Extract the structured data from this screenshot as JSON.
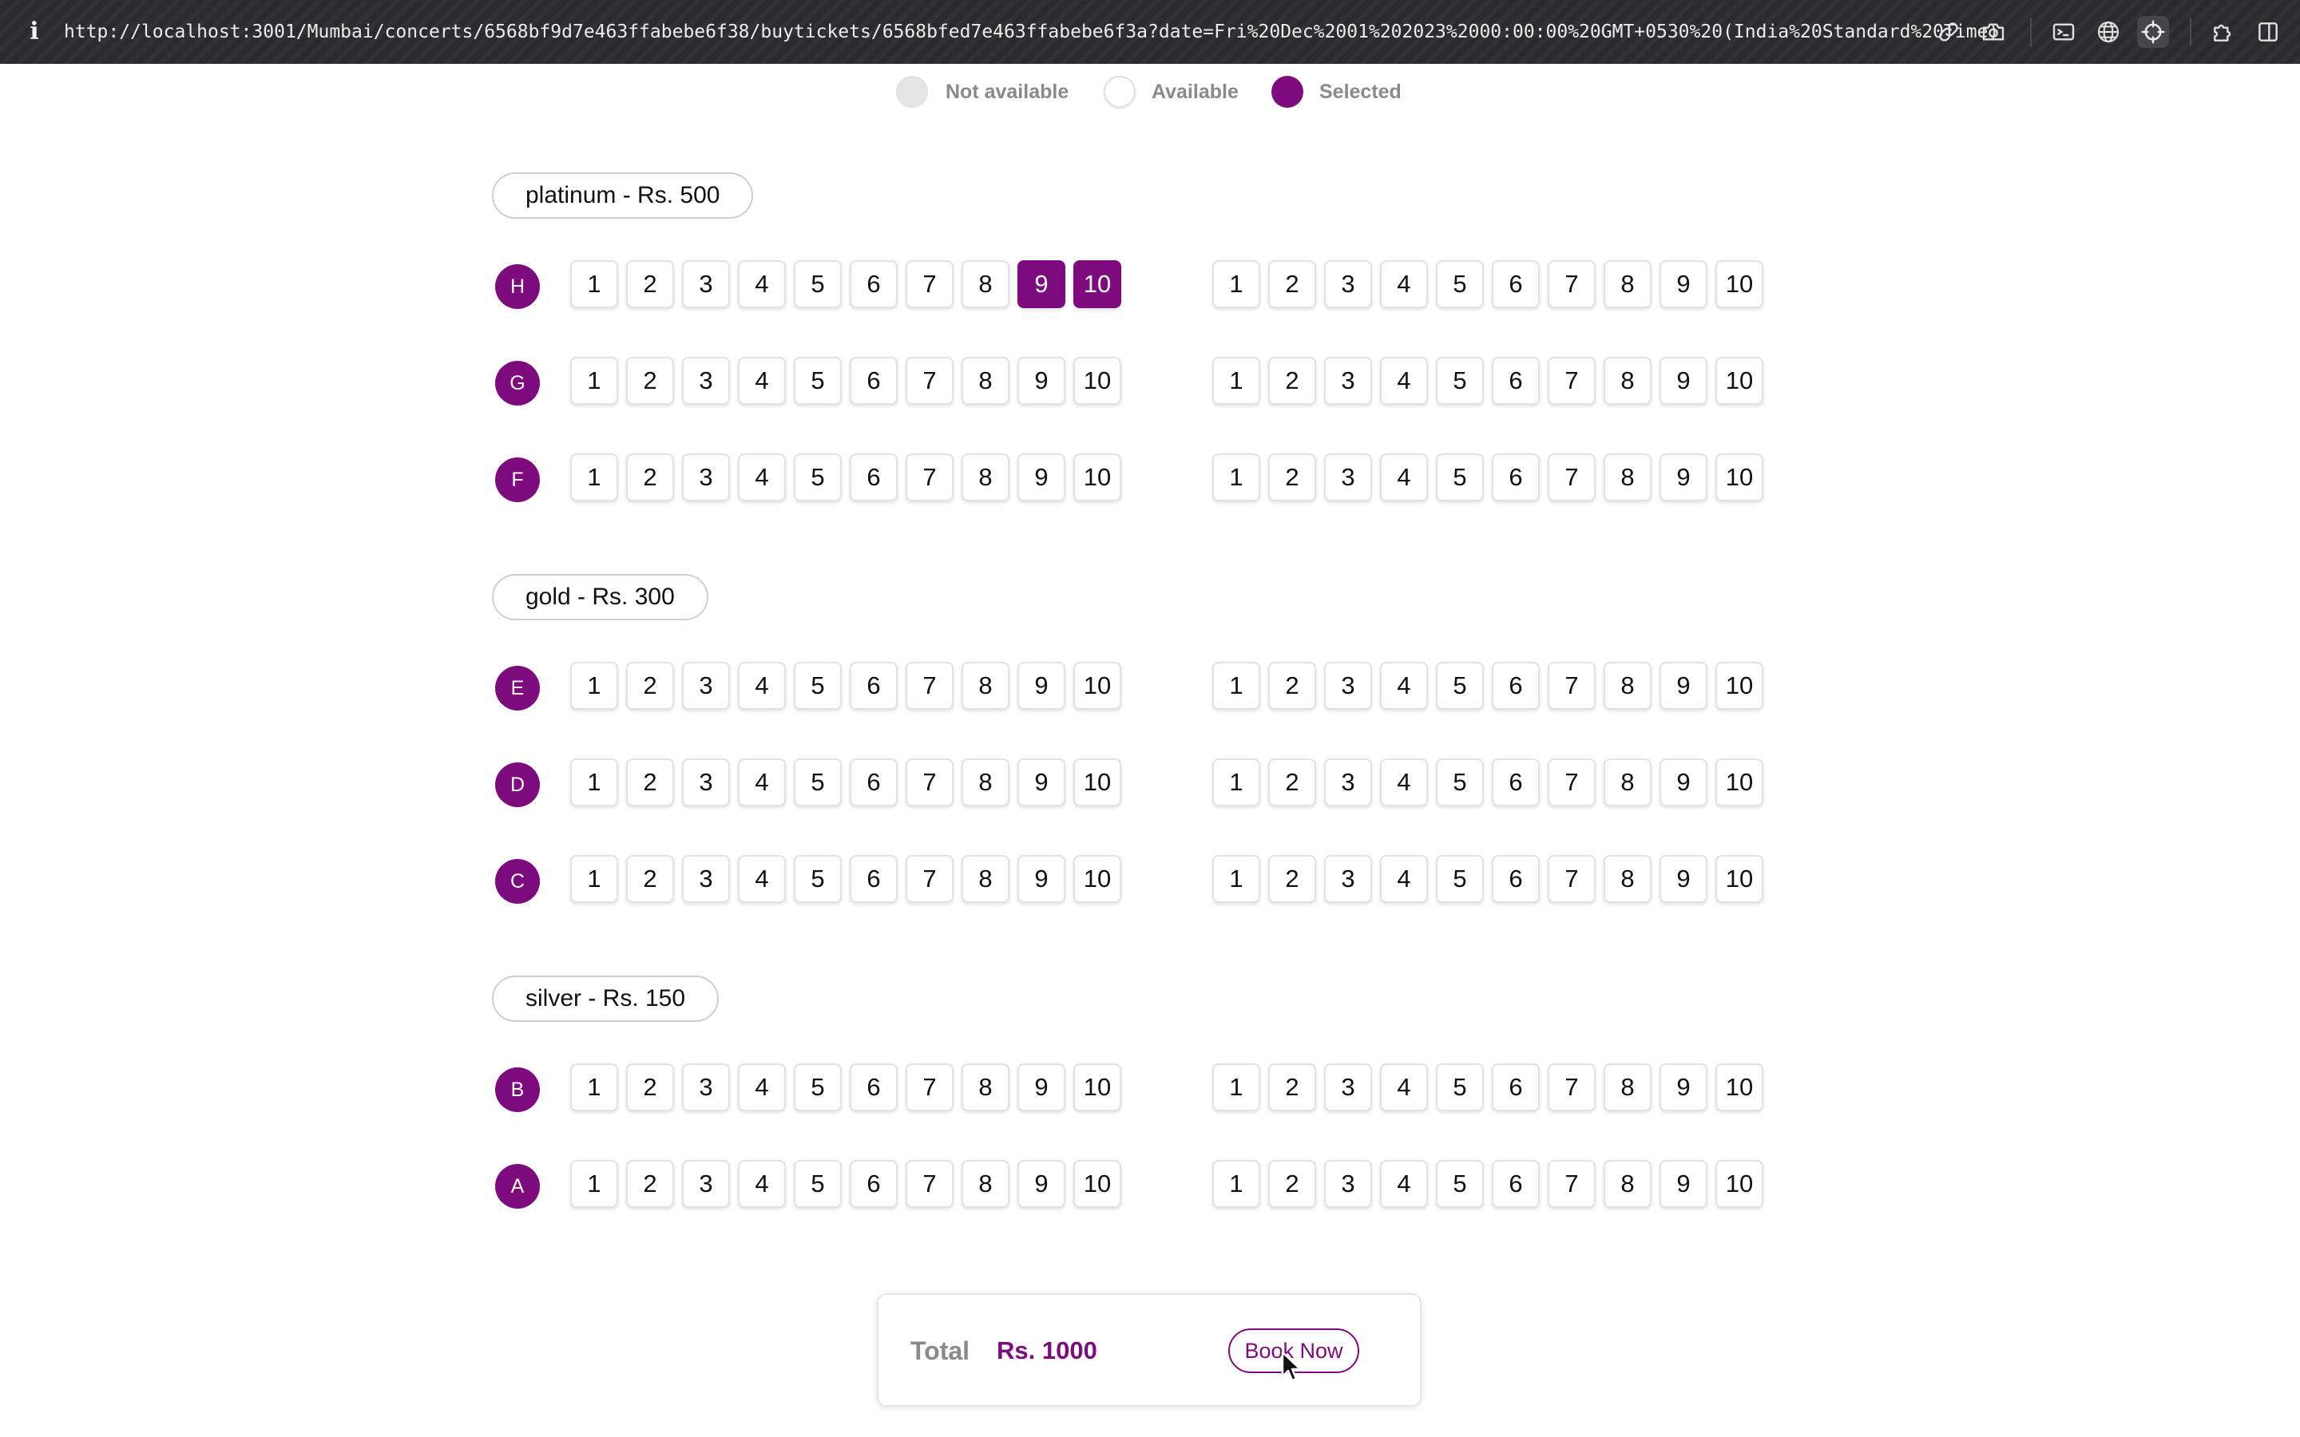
{
  "browser": {
    "url": "http://localhost:3001/Mumbai/concerts/6568bf9d7e463ffabebe6f38/buytickets/6568bfed7e463ffabebe6f3a?date=Fri%20Dec%2001%202023%2000:00:00%20GMT+0530%20(India%20Standard%20Time)",
    "icons": [
      "info-icon",
      "link-icon",
      "camera-icon",
      "terminal-icon",
      "globe-icon",
      "crosshair-icon",
      "puzzle-icon",
      "sidebar-icon"
    ]
  },
  "legend": {
    "not_available": "Not available",
    "available": "Available",
    "selected": "Selected"
  },
  "colors": {
    "accent": "#7e0b7e",
    "not_available": "#e5e5e5",
    "muted_text": "#8a8a8a"
  },
  "categories": [
    {
      "label": "platinum - Rs. 500",
      "rows": [
        {
          "label": "H",
          "left": [
            "1",
            "2",
            "3",
            "4",
            "5",
            "6",
            "7",
            "8",
            "9",
            "10"
          ],
          "right": [
            "1",
            "2",
            "3",
            "4",
            "5",
            "6",
            "7",
            "8",
            "9",
            "10"
          ],
          "selected_left": [
            "9",
            "10"
          ],
          "selected_right": []
        },
        {
          "label": "G",
          "left": [
            "1",
            "2",
            "3",
            "4",
            "5",
            "6",
            "7",
            "8",
            "9",
            "10"
          ],
          "right": [
            "1",
            "2",
            "3",
            "4",
            "5",
            "6",
            "7",
            "8",
            "9",
            "10"
          ],
          "selected_left": [],
          "selected_right": []
        },
        {
          "label": "F",
          "left": [
            "1",
            "2",
            "3",
            "4",
            "5",
            "6",
            "7",
            "8",
            "9",
            "10"
          ],
          "right": [
            "1",
            "2",
            "3",
            "4",
            "5",
            "6",
            "7",
            "8",
            "9",
            "10"
          ],
          "selected_left": [],
          "selected_right": []
        }
      ]
    },
    {
      "label": "gold - Rs. 300",
      "rows": [
        {
          "label": "E",
          "left": [
            "1",
            "2",
            "3",
            "4",
            "5",
            "6",
            "7",
            "8",
            "9",
            "10"
          ],
          "right": [
            "1",
            "2",
            "3",
            "4",
            "5",
            "6",
            "7",
            "8",
            "9",
            "10"
          ],
          "selected_left": [],
          "selected_right": []
        },
        {
          "label": "D",
          "left": [
            "1",
            "2",
            "3",
            "4",
            "5",
            "6",
            "7",
            "8",
            "9",
            "10"
          ],
          "right": [
            "1",
            "2",
            "3",
            "4",
            "5",
            "6",
            "7",
            "8",
            "9",
            "10"
          ],
          "selected_left": [],
          "selected_right": []
        },
        {
          "label": "C",
          "left": [
            "1",
            "2",
            "3",
            "4",
            "5",
            "6",
            "7",
            "8",
            "9",
            "10"
          ],
          "right": [
            "1",
            "2",
            "3",
            "4",
            "5",
            "6",
            "7",
            "8",
            "9",
            "10"
          ],
          "selected_left": [],
          "selected_right": []
        }
      ]
    },
    {
      "label": "silver - Rs. 150",
      "rows": [
        {
          "label": "B",
          "left": [
            "1",
            "2",
            "3",
            "4",
            "5",
            "6",
            "7",
            "8",
            "9",
            "10"
          ],
          "right": [
            "1",
            "2",
            "3",
            "4",
            "5",
            "6",
            "7",
            "8",
            "9",
            "10"
          ],
          "selected_left": [],
          "selected_right": []
        },
        {
          "label": "A",
          "left": [
            "1",
            "2",
            "3",
            "4",
            "5",
            "6",
            "7",
            "8",
            "9",
            "10"
          ],
          "right": [
            "1",
            "2",
            "3",
            "4",
            "5",
            "6",
            "7",
            "8",
            "9",
            "10"
          ],
          "selected_left": [],
          "selected_right": []
        }
      ]
    }
  ],
  "summary": {
    "total_label": "Total",
    "total_amount": "Rs. 1000",
    "book_button": "Book Now"
  }
}
